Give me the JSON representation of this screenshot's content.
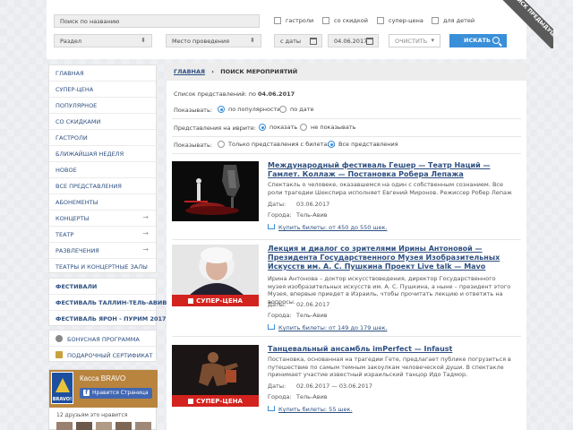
{
  "search": {
    "name_placeholder": "Поиск по названию",
    "section_label": "Раздел",
    "venue_label": "Место проведения",
    "date_from_placeholder": "с даты",
    "date_to_value": "04.06.2017",
    "clear_label": "ОЧИСТИТЬ",
    "search_label": "ИСКАТЬ",
    "checkboxes": [
      "гастроли",
      "со скидкой",
      "супер-цена",
      "для детей"
    ],
    "corner_ribbon": "ПОИСК ПРЕДЫДУЩИЕ"
  },
  "menu": {
    "items": [
      "ГЛАВНАЯ",
      "СУПЕР-ЦЕНА",
      "ПОПУЛЯРНОЕ",
      "СО СКИДКАМИ",
      "ГАСТРОЛИ",
      "БЛИЖАЙШАЯ НЕДЕЛЯ",
      "НОВОЕ",
      "ВСЕ ПРЕДСТАВЛЕНИЯ",
      "АБОНЕМЕНТЫ",
      "КОНЦЕРТЫ",
      "ТЕАТР",
      "РАЗВЛЕЧЕНИЯ",
      "ТЕАТРЫ И КОНЦЕРТНЫЕ ЗАЛЫ"
    ],
    "festivals": [
      "ФЕСТИВАЛИ",
      "ФЕСТИВАЛЬ ТАЛЛИН-ТЕЛЬ-АВИВ",
      "ФЕСТИВАЛЬ ЯРОН - ПУРИМ 2017"
    ],
    "extras": [
      "БОНУСНАЯ ПРОГРАММА",
      "ПОДАРОЧНЫЙ СЕРТИФИКАТ"
    ]
  },
  "widget": {
    "title": "Касса BRAVO",
    "logo_text": "BRAVO!",
    "like_label": "Нравится Страница",
    "friends_text": "12 друзьям это нравится"
  },
  "main": {
    "breadcrumb_home": "ГЛАВНАЯ",
    "breadcrumb_sep": "›",
    "breadcrumb_current": "ПОИСК МЕРОПРИЯТИЙ",
    "list_title_prefix": "Список представлений: по",
    "list_title_date": "04.06.2017",
    "sort_label": "Показывать:",
    "sort_options": [
      "по популярности",
      "по дате"
    ],
    "hebrew_label": "Представления на иврите:",
    "hebrew_options": [
      "показать",
      "не показывать"
    ],
    "show_label": "Показывать:",
    "show_options": [
      "Только представления с билетами",
      "Все представления"
    ]
  },
  "events": [
    {
      "title": "Международный фестиваль Гешер — Театр Наций — Гамлет. Коллаж — Постановка Робера Лепажа",
      "desc": "Спектакль о человеке, оказавшемся на один с собственным сознанием. Все роли трагедии Шекспира исполняет Евгений Миронов. Режиссер Робер Лепаж",
      "dates_label": "Даты:",
      "dates": "03.06.2017",
      "city_label": "Города:",
      "city": "Тель-Авив",
      "tickets": "Купить билеты: от 450 до 550 шек.",
      "super": ""
    },
    {
      "title": "Лекция и диалог со зрителями Ирины Антоновой — Президента Государственного Музея Изобразительных Искусств им. А. С. Пушкина Проект Live talk — Mavo",
      "desc": "Ирина Антонова – доктор искусствоведения, директор Государственного музея изобразительных искусств им. А. С. Пушкина, а ныне – президент этого Музея, впервые приедет в Израиль, чтобы прочитать лекцию и ответить на вопросы.",
      "dates_label": "Даты:",
      "dates": "02.06.2017",
      "city_label": "Города:",
      "city": "Тель-Авив",
      "tickets": "Купить билеты: от 149 до 179 шек.",
      "super": "СУПЕР-ЦЕНА"
    },
    {
      "title": "Танцевальный ансамбль imPerfect — Infaust",
      "desc": "Постановка, основанная на трагедии Гете, предлагает публике погрузиться в путешествие по самым темным закоулкам человеческой души. В спектакле принимает участие известный израильский танцор Идо Тадмор.",
      "dates_label": "Даты:",
      "dates": "02.06.2017 — 03.06.2017",
      "city_label": "Города:",
      "city": "Тель-Авив",
      "tickets": "Купить билеты: 55 шек.",
      "super": "СУПЕР-ЦЕНА"
    }
  ],
  "colors": {
    "accent": "#3a8fd9",
    "link": "#2d4f80",
    "super": "#d3231e",
    "ribbon": "#5a5a5a"
  }
}
